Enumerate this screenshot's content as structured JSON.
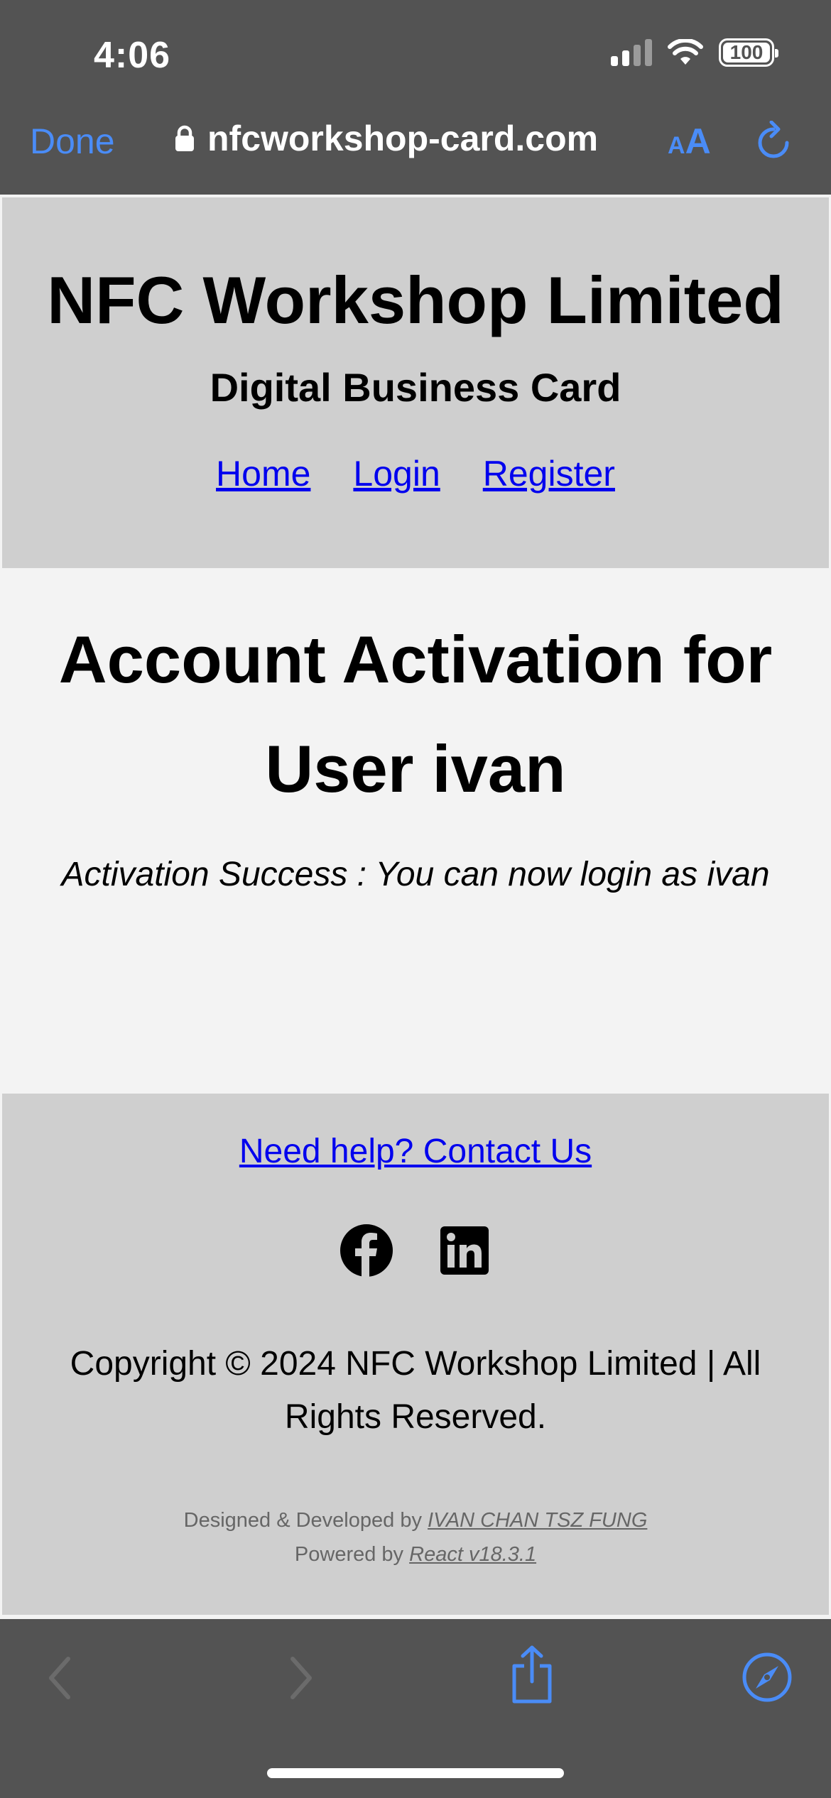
{
  "status_bar": {
    "time": "4:06",
    "battery": "100",
    "icons": [
      "signal-icon",
      "wifi-icon",
      "battery-icon"
    ]
  },
  "browser": {
    "done_label": "Done",
    "url": "nfcworkshop-card.com",
    "text_size_small": "A",
    "text_size_big": "A",
    "icons": [
      "lock-icon",
      "reload-icon",
      "back-icon",
      "forward-icon",
      "share-icon",
      "compass-icon"
    ],
    "accent_color": "#4a8cf7",
    "bar_color": "#535353"
  },
  "header": {
    "title": "NFC Workshop Limited",
    "subtitle": "Digital Business Card",
    "nav": [
      "Home",
      "Login",
      "Register"
    ],
    "background": "#cfcfcf",
    "link_color": "#0000ee"
  },
  "main": {
    "heading_line1": "Account Activation for",
    "heading_line2": "User ivan",
    "message": "Activation Success : You can now login as ivan"
  },
  "footer": {
    "help_link": "Need help? Contact Us",
    "social_icons": [
      "facebook-icon",
      "linkedin-icon"
    ],
    "copyright_line1": "Copyright © 2024 NFC Workshop Limited | All",
    "copyright_line2": "Rights Reserved.",
    "designed_prefix": "Designed & Developed by",
    "designer": "IVAN CHAN TSZ FUNG",
    "powered_prefix": "Powered by",
    "powered": "React v18.3.1"
  }
}
